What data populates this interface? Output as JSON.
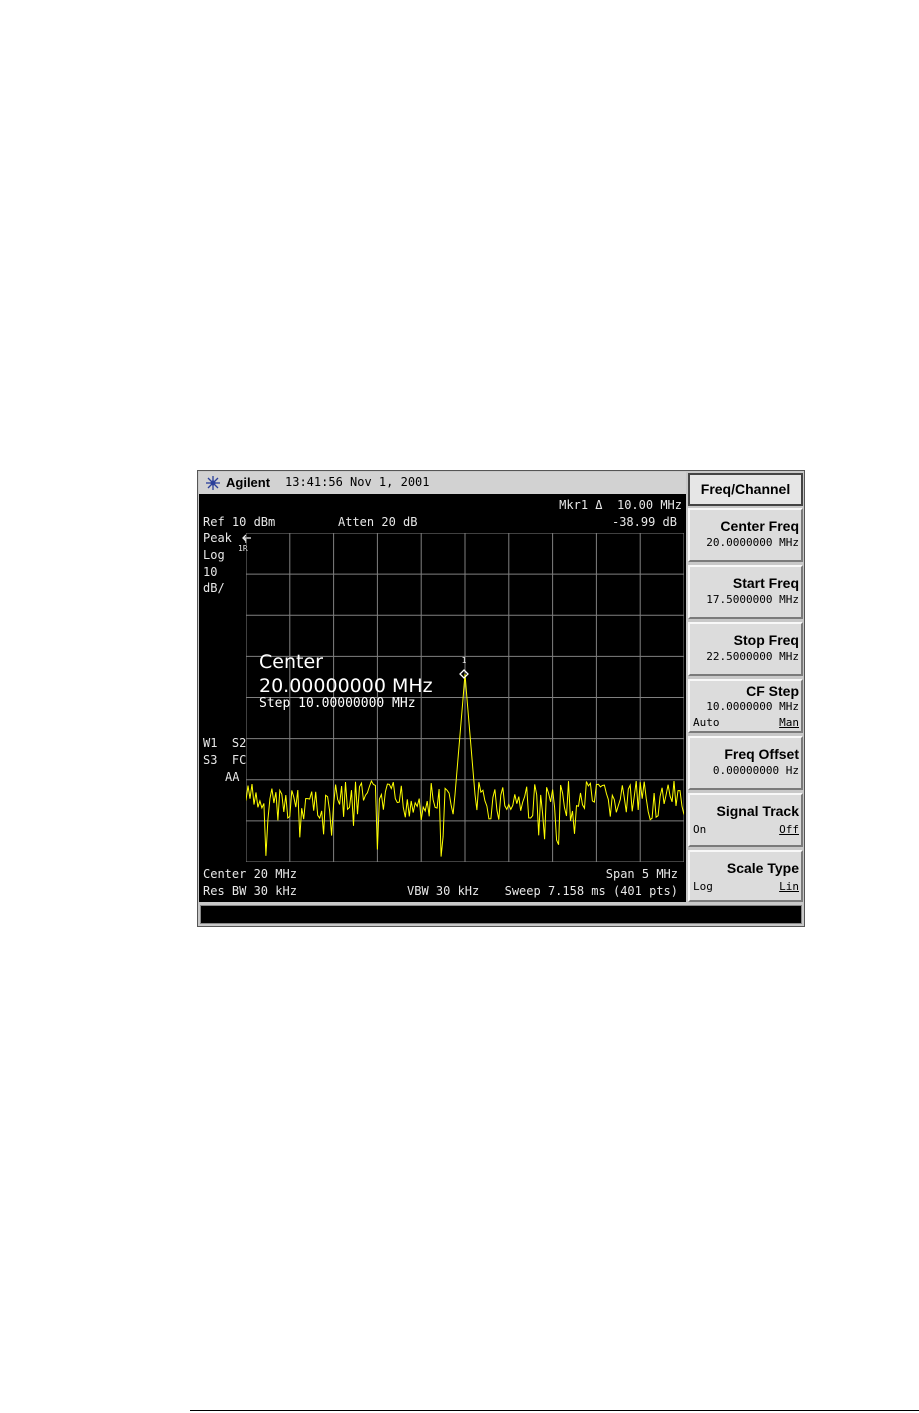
{
  "header": {
    "brand": "Agilent",
    "time": "13:41:56  Nov 1, 2001"
  },
  "marker": {
    "line1": "Mkr1 Δ  10.00 MHz",
    "line2": "-38.99 dB",
    "label": "1",
    "ref_label": "1R"
  },
  "ref": {
    "ref_level": "Ref 10 dBm",
    "atten": "Atten 20 dB",
    "detector": "Peak",
    "scale_type": "Log",
    "scale_value": "10",
    "scale_unit": "dB/"
  },
  "left_annotations": {
    "line1": "W1  S2",
    "line2": "S3  FC",
    "line3": "AA"
  },
  "entry": {
    "title": "Center",
    "value": "20.00000000 MHz",
    "step": "Step 10.00000000 MHz"
  },
  "bottom": {
    "center": "Center 20 MHz",
    "span": "Span 5 MHz",
    "rbw": "Res BW 30 kHz",
    "vbw": "VBW 30 kHz",
    "sweep": "Sweep 7.158 ms (401 pts)"
  },
  "menu": {
    "title": "Freq/Channel",
    "keys": [
      {
        "label": "Center Freq",
        "value": "20.0000000 MHz"
      },
      {
        "label": "Start Freq",
        "value": "17.5000000 MHz"
      },
      {
        "label": "Stop Freq",
        "value": "22.5000000 MHz"
      },
      {
        "label": "CF Step",
        "value": "10.0000000 MHz",
        "left": "Auto",
        "right": "Man"
      },
      {
        "label": "Freq Offset",
        "value": "0.00000000  Hz"
      },
      {
        "label": "Signal Track",
        "left": "On",
        "right": "Off"
      },
      {
        "label": "Scale Type",
        "left": "Log",
        "right": "Lin"
      }
    ]
  },
  "colors": {
    "trace": "#ffff00",
    "grid": "#808080",
    "screen": "#000000"
  }
}
